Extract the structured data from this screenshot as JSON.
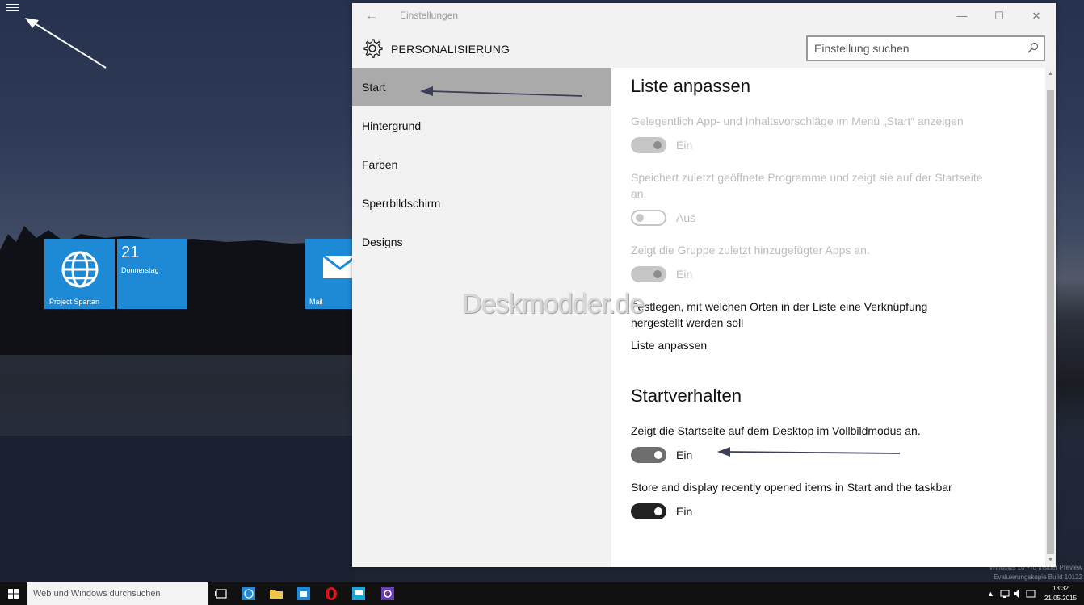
{
  "desktop": {
    "tiles": [
      {
        "label": "Project Spartan",
        "icon": "globe-icon"
      },
      {
        "day": "21",
        "weekday": "Donnerstag"
      },
      {
        "label": "Mail",
        "icon": "mail-icon"
      }
    ],
    "watermark": "Deskmodder.de",
    "eval_lines": [
      "Windows 10 Pro Insider Preview",
      "Evaluierungskopie Build 10122"
    ]
  },
  "window": {
    "title": "Einstellungen",
    "back_icon": "←",
    "min_icon": "—",
    "max_icon": "☐",
    "close_icon": "✕",
    "page_heading": "PERSONALISIERUNG",
    "search": {
      "placeholder": "Einstellung suchen",
      "value": ""
    }
  },
  "nav": {
    "items": [
      {
        "label": "Start",
        "active": true
      },
      {
        "label": "Hintergrund"
      },
      {
        "label": "Farben"
      },
      {
        "label": "Sperrbildschirm"
      },
      {
        "label": "Designs"
      }
    ]
  },
  "content": {
    "section1_title": "Liste anpassen",
    "setting1": {
      "text": "Gelegentlich App- und Inhaltsvorschläge im Menü „Start“ anzeigen",
      "state": "Ein"
    },
    "setting2": {
      "text": "Speichert zuletzt geöffnete Programme und zeigt sie auf der Startseite an.",
      "state": "Aus"
    },
    "setting3": {
      "text": "Zeigt die Gruppe zuletzt hinzugefügter Apps an.",
      "state": "Ein"
    },
    "setting4_text": "Festlegen, mit welchen Orten in der Liste eine Verknüpfung hergestellt werden soll",
    "link_label": "Liste anpassen",
    "section2_title": "Startverhalten",
    "setting5": {
      "text": "Zeigt die Startseite auf dem Desktop im Vollbildmodus an.",
      "state": "Ein"
    },
    "setting6": {
      "text": "Store and display recently opened items in Start and the taskbar",
      "state": "Ein"
    }
  },
  "taskbar": {
    "search_placeholder": "Web und Windows durchsuchen",
    "time": "13:32",
    "date": "21.05.2015"
  },
  "colors": {
    "tile_blue": "#1e8ad6",
    "nav_active": "#aaaaaa",
    "taskbar": "#101010"
  }
}
